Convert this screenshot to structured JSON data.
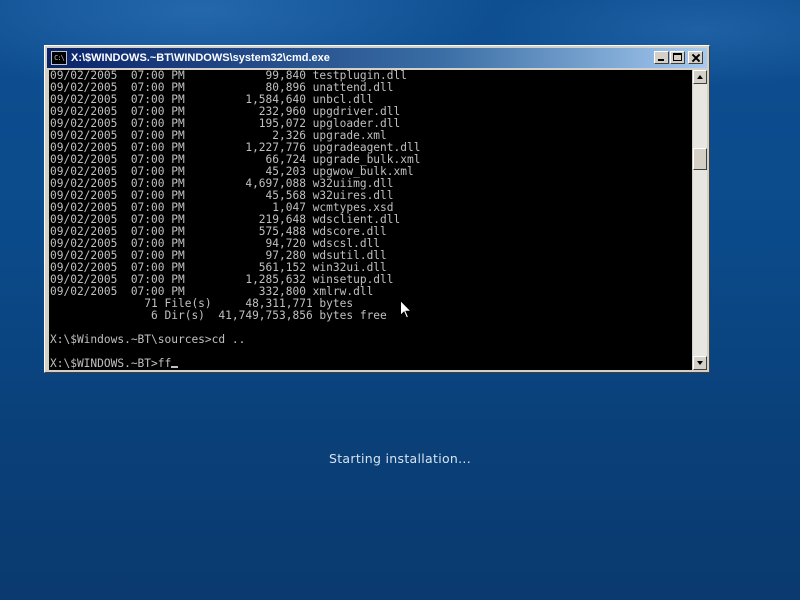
{
  "window": {
    "title": "X:\\$WINDOWS.~BT\\WINDOWS\\system32\\cmd.exe",
    "icon_label": "C:\\",
    "icon": "console-icon"
  },
  "console": {
    "lines": [
      "09/02/2005  07:00 PM            99,840 testplugin.dll",
      "09/02/2005  07:00 PM            80,896 unattend.dll",
      "09/02/2005  07:00 PM         1,584,640 unbcl.dll",
      "09/02/2005  07:00 PM           232,960 upgdriver.dll",
      "09/02/2005  07:00 PM           195,072 upgloader.dll",
      "09/02/2005  07:00 PM             2,326 upgrade.xml",
      "09/02/2005  07:00 PM         1,227,776 upgradeagent.dll",
      "09/02/2005  07:00 PM            66,724 upgrade_bulk.xml",
      "09/02/2005  07:00 PM            45,203 upgwow_bulk.xml",
      "09/02/2005  07:00 PM         4,697,088 w32uiimg.dll",
      "09/02/2005  07:00 PM            45,568 w32uires.dll",
      "09/02/2005  07:00 PM             1,047 wcmtypes.xsd",
      "09/02/2005  07:00 PM           219,648 wdsclient.dll",
      "09/02/2005  07:00 PM           575,488 wdscore.dll",
      "09/02/2005  07:00 PM            94,720 wdscsl.dll",
      "09/02/2005  07:00 PM            97,280 wdsutil.dll",
      "09/02/2005  07:00 PM           561,152 win32ui.dll",
      "09/02/2005  07:00 PM         1,285,632 winsetup.dll",
      "09/02/2005  07:00 PM           332,800 xmlrw.dll",
      "              71 File(s)     48,311,771 bytes",
      "               6 Dir(s)  41,749,753,856 bytes free",
      "",
      "X:\\$Windows.~BT\\sources>cd ..",
      ""
    ],
    "prompt": "X:\\$WINDOWS.~BT>ff"
  },
  "status": {
    "text": "Starting installation..."
  },
  "colors": {
    "desktop_bg": "#0b4a8a",
    "titlebar_active": "#0a246a",
    "console_bg": "#000000",
    "console_fg": "#c0c0c0"
  }
}
